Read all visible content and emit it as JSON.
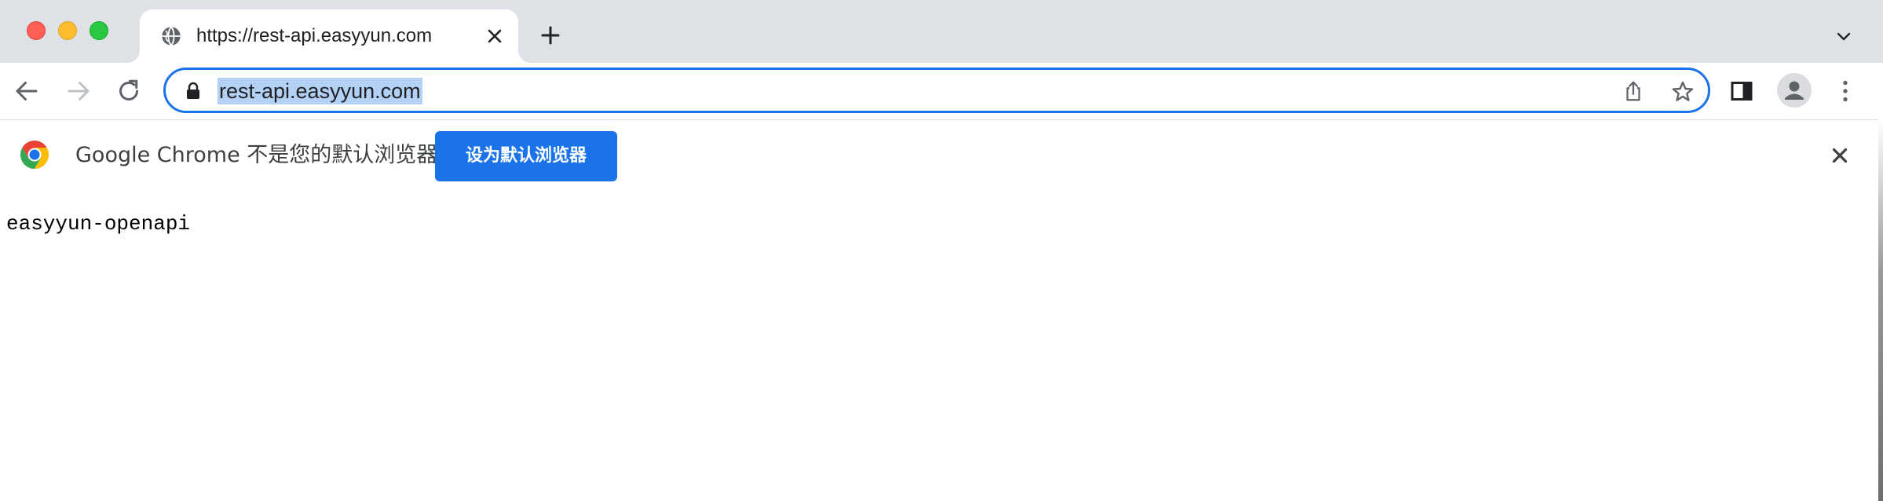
{
  "window": {
    "traffic_lights": [
      "close",
      "minimize",
      "zoom"
    ]
  },
  "tab": {
    "title": "https://rest-api.easyyun.com",
    "favicon": "globe-icon"
  },
  "toolbar": {
    "url": "rest-api.easyyun.com",
    "url_selected": true
  },
  "infobar": {
    "message": "Google Chrome 不是您的默认浏览器",
    "button_label": "设为默认浏览器"
  },
  "page": {
    "body_text": "easyyun-openapi"
  },
  "colors": {
    "accent": "#1a73e8",
    "tabstrip_bg": "#dee1e6",
    "selection": "#b3d0f5"
  }
}
